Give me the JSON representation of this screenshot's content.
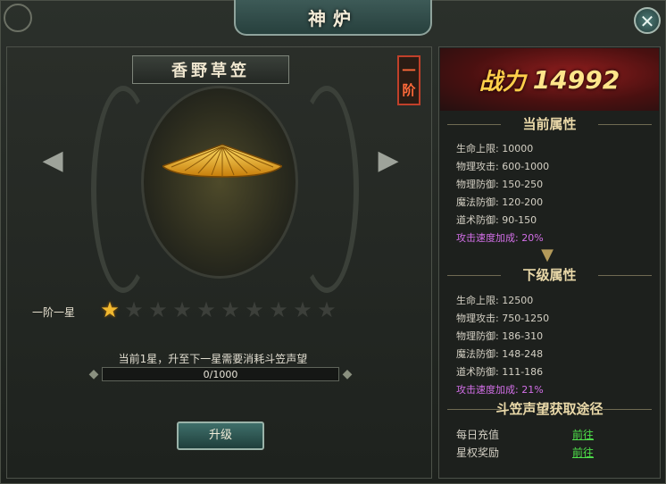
{
  "window": {
    "title": "神炉"
  },
  "item": {
    "name": "香野草笠",
    "stage_badge": "一阶",
    "star_label": "一阶一星",
    "stars_total": 10,
    "stars_filled": 1,
    "requirement_text": "当前1星，升至下一星需要消耗斗笠声望",
    "progress_text": "0/1000",
    "progress_fraction": 0.0,
    "upgrade_label": "升级"
  },
  "power": {
    "label": "战力",
    "value": "14992"
  },
  "current": {
    "title": "当前属性",
    "attrs": [
      {
        "text": "生命上限: 10000"
      },
      {
        "text": "物理攻击: 600-1000"
      },
      {
        "text": "物理防御: 150-250"
      },
      {
        "text": "魔法防御: 120-200"
      },
      {
        "text": "道术防御: 90-150"
      },
      {
        "text": "攻击速度加成: 20%"
      }
    ]
  },
  "next": {
    "title": "下级属性",
    "attrs": [
      {
        "text": "生命上限: 12500"
      },
      {
        "text": "物理攻击: 750-1250"
      },
      {
        "text": "物理防御: 186-310"
      },
      {
        "text": "魔法防御: 148-248"
      },
      {
        "text": "道术防御: 111-186"
      },
      {
        "text": "攻击速度加成: 21%"
      }
    ]
  },
  "routes": {
    "title": "斗笠声望获取途径",
    "items": [
      {
        "name": "每日充值",
        "link": "前往"
      },
      {
        "name": "星权奖励",
        "link": "前往"
      }
    ]
  },
  "colors": {
    "accent_gold": "#f2b930",
    "link_green": "#4ee04a",
    "special_attr": "#d36fe8",
    "power_red": "#8e1d1d"
  },
  "icons": {
    "close": "close-icon",
    "prev": "arrow-left-icon",
    "next": "arrow-right-icon",
    "item": "straw-hat-icon"
  }
}
